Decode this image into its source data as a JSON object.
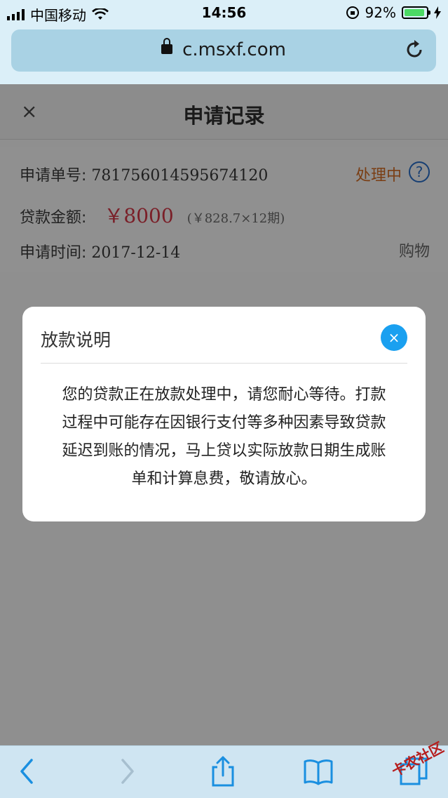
{
  "status_bar": {
    "carrier": "中国移动",
    "time": "14:56",
    "battery_percent_label": "92%",
    "battery_level": 0.92
  },
  "browser": {
    "url": "c.msxf.com"
  },
  "header": {
    "close_glyph": "×",
    "title": "申请记录"
  },
  "record": {
    "number_label": "申请单号:",
    "number_value": "781756014595674120",
    "status": "处理中",
    "help_glyph": "?",
    "amount_label": "贷款金额:",
    "amount_value": "￥8000",
    "installment": "(￥828.7×12期)",
    "time_label": "申请时间:",
    "time_value": "2017-12-14",
    "category": "购物"
  },
  "modal": {
    "title": "放款说明",
    "close_glyph": "×",
    "lines": [
      "您的贷款正在放款处理中，请您耐心等待。打款",
      "过程中可能存在因银行支付等多种因素导致贷款",
      "延迟到账的情况，马上贷以实际放款日期生成账",
      "单和计算息费，敬请放心。"
    ]
  },
  "toolbar": {
    "icons": [
      "back-icon",
      "forward-icon",
      "share-icon",
      "bookmarks-icon",
      "tabs-icon"
    ]
  },
  "watermark": "卡农社区",
  "colors": {
    "accent_blue": "#1aa0f0",
    "status_text": "#7a3e14",
    "amount_text": "#7a1f28",
    "battery_green": "#4cd964"
  }
}
